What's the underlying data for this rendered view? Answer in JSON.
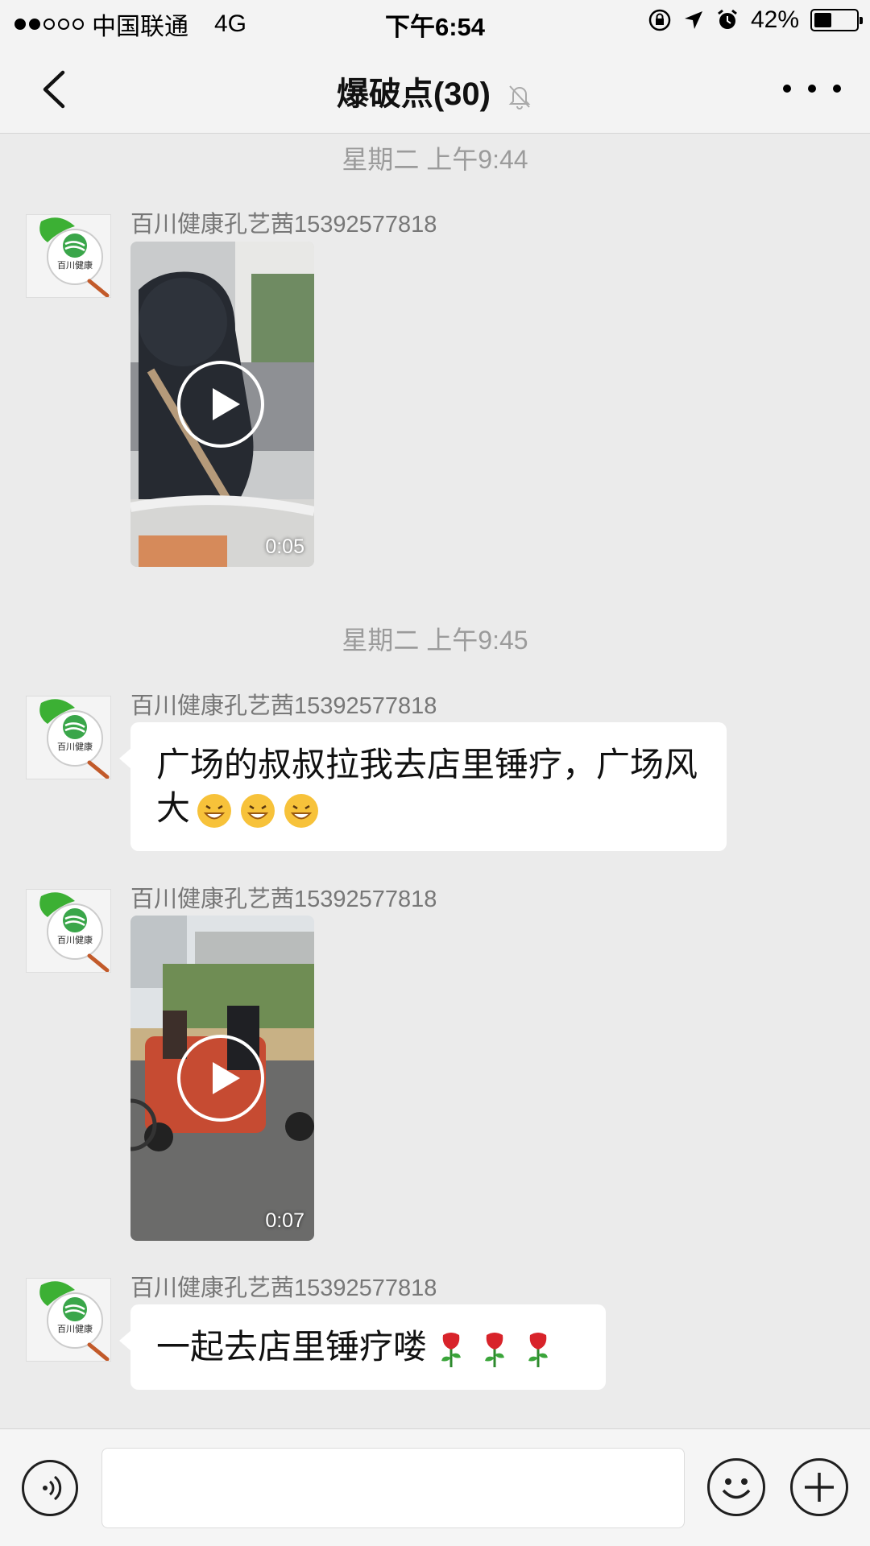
{
  "status_bar": {
    "carrier": "中国联通",
    "network": "4G",
    "time": "下午6:54",
    "battery_text": "42%",
    "battery_level": 0.42,
    "signal_bars_filled": 2,
    "signal_bars_total": 5
  },
  "nav": {
    "title": "爆破点(30)",
    "back_icon": "chevron-left-icon",
    "mute_icon": "bell-muted-icon",
    "more_icon": "more-dots-icon"
  },
  "messages": {
    "ts1": "星期二 上午9:44",
    "ts2": "星期二 上午9:45",
    "m1": {
      "sender": "百川健康孔艺茜15392577818",
      "type": "video",
      "duration": "0:05"
    },
    "m2": {
      "sender": "百川健康孔艺茜15392577818",
      "type": "text",
      "text": "广场的叔叔拉我去店里锤疗，广场风大",
      "emojis": "grinning-face x3"
    },
    "m3": {
      "sender": "百川健康孔艺茜15392577818",
      "type": "video",
      "duration": "0:07"
    },
    "m4": {
      "sender": "百川健康孔艺茜15392577818",
      "type": "text",
      "text": "一起去店里锤疗喽",
      "emojis": "rose x3"
    },
    "avatar_label": "百川健康"
  },
  "input_bar": {
    "placeholder": "",
    "voice_icon": "voice-icon",
    "emoji_icon": "smiley-icon",
    "plus_icon": "plus-icon"
  },
  "colors": {
    "background": "#ebebeb",
    "bar": "#f3f3f3",
    "accent_green": "#3cb034",
    "meta_gray": "#9b9b9b"
  }
}
